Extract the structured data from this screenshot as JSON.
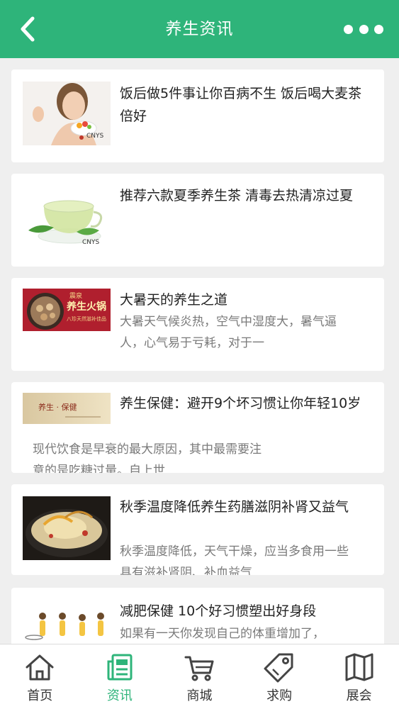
{
  "header": {
    "title": "养生资讯",
    "back_icon": "chevron-left-icon",
    "more_icon": "more-dots-icon"
  },
  "articles": [
    {
      "title": "饭后做5件事让你百病不生 饭后喝大麦茶倍好",
      "summary": "",
      "thumb_icon": "woman-fruit-photo",
      "watermark": "CNYS"
    },
    {
      "title": "推荐六款夏季养生茶 清毒去热清凉过夏",
      "summary": "",
      "thumb_icon": "green-tea-cup-photo",
      "watermark": "CNYS"
    },
    {
      "title": "大暑天的养生之道",
      "summary": "大暑天气候炎热，空气中湿度大，暑气逼人，心气易于亏耗，对于一",
      "thumb_icon": "hotpot-banner-photo",
      "banner_small": "震泉",
      "banner_text": "养生火锅",
      "banner_sub": "八珍天然滋补佳品"
    },
    {
      "title": "养生保健：避开9个坏习惯让你年轻10岁",
      "summary": "现代饮食是早衰的最大原因，其中最需要注意的是吃糖过量。自上世",
      "thumb_icon": "health-banner-photo",
      "banner_text": "养生 · 保健"
    },
    {
      "title": "秋季温度降低养生药膳滋阴补肾又益气",
      "summary": "秋季温度降低，天气干燥，应当多食用一些具有滋补肾阴、补血益气",
      "thumb_icon": "herbal-chicken-soup-photo"
    },
    {
      "title": "减肥保健 10个好习惯塑出好身段",
      "summary": "如果有一天你发现自己的体重增加了，",
      "thumb_icon": "fitness-women-photo"
    }
  ],
  "tabbar": {
    "active": 1,
    "items": [
      {
        "label": "首页",
        "icon": "home-icon"
      },
      {
        "label": "资讯",
        "icon": "news-icon"
      },
      {
        "label": "商城",
        "icon": "cart-icon"
      },
      {
        "label": "求购",
        "icon": "tag-icon"
      },
      {
        "label": "展会",
        "icon": "map-icon"
      }
    ]
  },
  "colors": {
    "brand": "#2eb47a",
    "background": "#efefef",
    "title_text": "#222222",
    "summary_text": "#7a7a7a"
  }
}
